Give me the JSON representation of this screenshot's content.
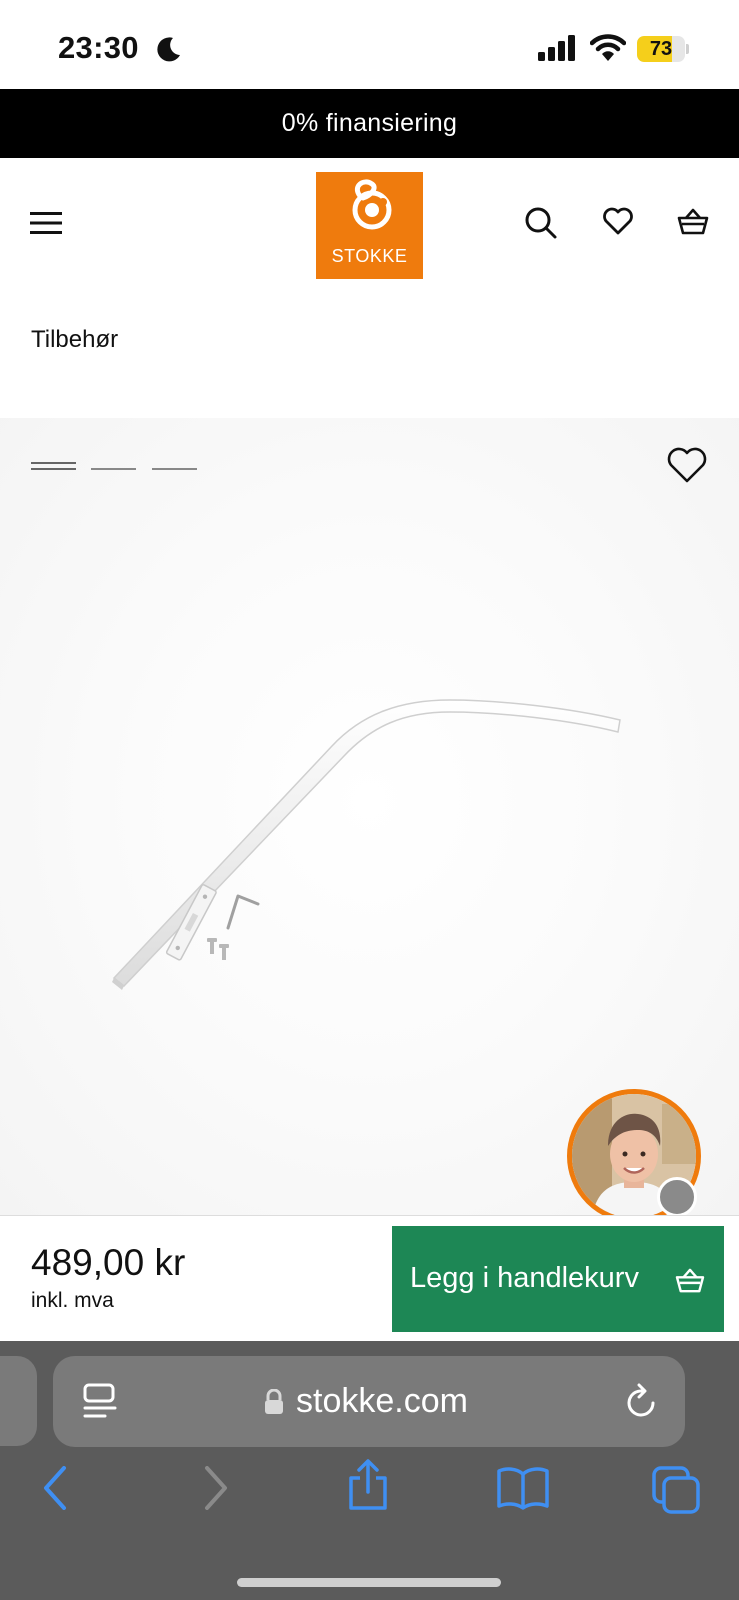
{
  "status_bar": {
    "time": "23:30",
    "battery_level": "73",
    "battery_fraction": 0.73,
    "icons": [
      "moon-icon",
      "cellular-signal-icon",
      "wifi-icon",
      "battery-icon"
    ]
  },
  "promo_banner": {
    "text": "0% finansiering"
  },
  "header": {
    "logo_text": "STOKKE",
    "brand_color": "#ef7b0d",
    "icons": [
      "menu-icon",
      "search-icon",
      "heart-icon",
      "basket-icon"
    ]
  },
  "breadcrumb": {
    "label": "Tilbehør"
  },
  "gallery": {
    "slides_total": 3,
    "active_slide": 1,
    "product_image": "white canopy rod with mounting bracket, screws and allen key"
  },
  "purchase": {
    "price": "489,00 kr",
    "price_note": "inkl. mva",
    "add_to_cart_label": "Legg i handlekurv",
    "button_color": "#1d8755"
  },
  "browser": {
    "url": "stokke.com",
    "toolbar_icons": [
      "back-icon",
      "forward-icon",
      "share-icon",
      "bookmarks-icon",
      "tabs-icon"
    ],
    "accent_color": "#3f8ff2"
  }
}
